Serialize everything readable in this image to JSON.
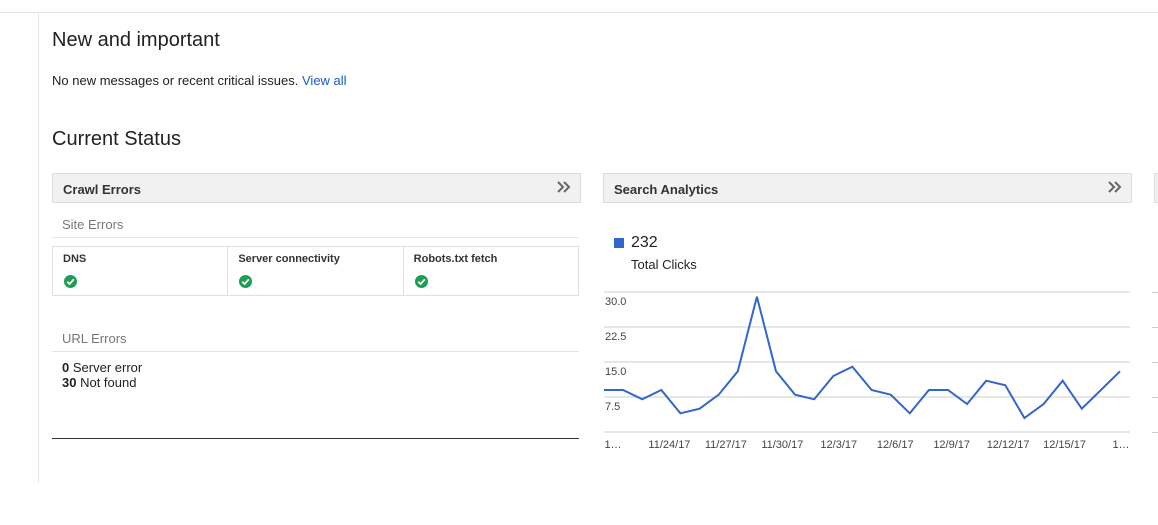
{
  "new_section": {
    "title": "New and important",
    "message": "No new messages or recent critical issues.",
    "view_all": "View all"
  },
  "status_section": {
    "title": "Current Status"
  },
  "crawl_errors": {
    "title": "Crawl Errors",
    "site_errors_label": "Site Errors",
    "site_errors": [
      {
        "label": "DNS",
        "status": "ok"
      },
      {
        "label": "Server connectivity",
        "status": "ok"
      },
      {
        "label": "Robots.txt fetch",
        "status": "ok"
      }
    ],
    "url_errors_label": "URL Errors",
    "url_errors": [
      {
        "count": "0",
        "label": "Server error"
      },
      {
        "count": "30",
        "label": "Not found"
      }
    ]
  },
  "search_analytics": {
    "title": "Search Analytics",
    "total_value": "232",
    "total_label": "Total Clicks",
    "series_color": "#3366cc"
  },
  "chart_data": {
    "type": "line",
    "series": [
      {
        "name": "Total Clicks",
        "color": "#3366cc"
      }
    ],
    "x_tick_labels": [
      "1…",
      "11/24/17",
      "11/27/17",
      "11/30/17",
      "12/3/17",
      "12/6/17",
      "12/9/17",
      "12/12/17",
      "12/15/17",
      "1…"
    ],
    "y_tick_labels": [
      "30.0",
      "22.5",
      "15.0",
      "7.5"
    ],
    "y_ticks": [
      30,
      22.5,
      15,
      7.5
    ],
    "ylim": [
      0,
      32
    ],
    "values": [
      9,
      9,
      7,
      9,
      4,
      5,
      8,
      13,
      29,
      13,
      8,
      7,
      12,
      14,
      9,
      8,
      4,
      9,
      9,
      6,
      11,
      10,
      3,
      6,
      11,
      5,
      9,
      13
    ],
    "grid": true
  }
}
